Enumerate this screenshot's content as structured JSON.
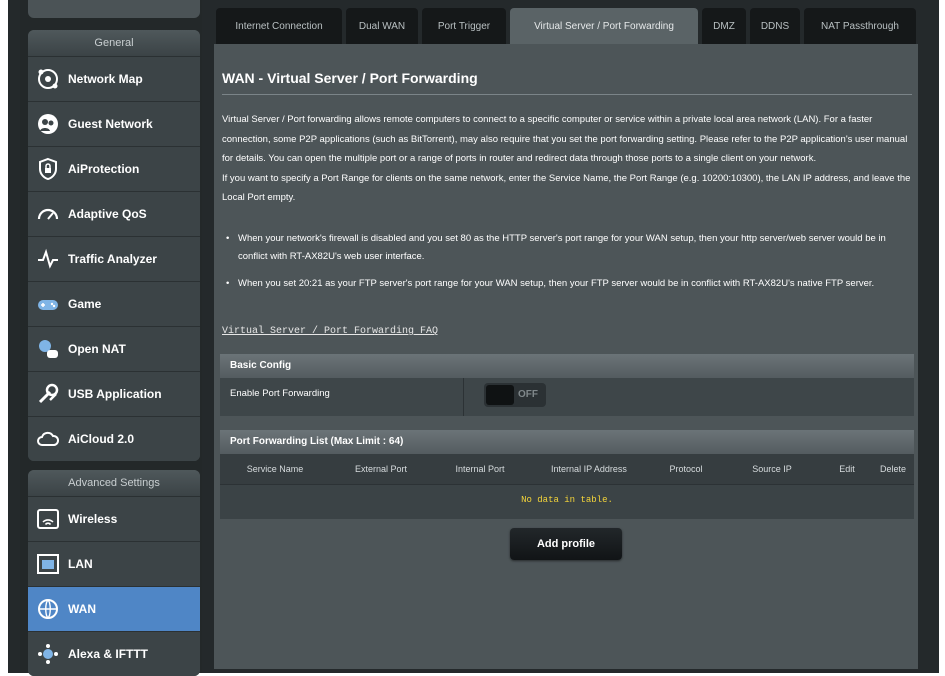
{
  "colors": {
    "accent": "#4f86c6",
    "no_data_text": "#f3d43a",
    "panel": "#4d5558",
    "sidebar_item": "#3c4447"
  },
  "tabs": [
    {
      "label": "Internet Connection",
      "active": false
    },
    {
      "label": "Dual WAN",
      "active": false
    },
    {
      "label": "Port Trigger",
      "active": false
    },
    {
      "label": "Virtual Server / Port Forwarding",
      "active": true
    },
    {
      "label": "DMZ",
      "active": false
    },
    {
      "label": "DDNS",
      "active": false
    },
    {
      "label": "NAT Passthrough",
      "active": false
    }
  ],
  "sidebar": {
    "general_header": "General",
    "general_items": [
      {
        "label": "Network Map",
        "icon": "network-map-icon"
      },
      {
        "label": "Guest Network",
        "icon": "guest-network-icon"
      },
      {
        "label": "AiProtection",
        "icon": "shield-lock-icon"
      },
      {
        "label": "Adaptive QoS",
        "icon": "speedometer-icon"
      },
      {
        "label": "Traffic Analyzer",
        "icon": "pulse-icon"
      },
      {
        "label": "Game",
        "icon": "gamepad-icon"
      },
      {
        "label": "Open NAT",
        "icon": "open-nat-icon"
      },
      {
        "label": "USB Application",
        "icon": "usb-tools-icon"
      },
      {
        "label": "AiCloud 2.0",
        "icon": "cloud-icon"
      }
    ],
    "advanced_header": "Advanced Settings",
    "advanced_items": [
      {
        "label": "Wireless",
        "icon": "wifi-icon",
        "active": false
      },
      {
        "label": "LAN",
        "icon": "lan-icon",
        "active": false
      },
      {
        "label": "WAN",
        "icon": "globe-icon",
        "active": true
      },
      {
        "label": "Alexa & IFTTT",
        "icon": "alexa-icon",
        "active": false
      }
    ]
  },
  "main": {
    "title": "WAN - Virtual Server / Port Forwarding",
    "description_1": "Virtual Server / Port forwarding allows remote computers to connect to a specific computer or service within a private local area network (LAN). For a faster connection, some P2P applications (such as BitTorrent), may also require that you set the port forwarding setting. Please refer to the P2P application's user manual for details. You can open the multiple port or a range of ports in router and redirect data through those ports to a single client on your network.",
    "description_2": "If you want to specify a Port Range for clients on the same network, enter the Service Name, the Port Range (e.g. 10200:10300), the LAN IP address, and leave the Local Port empty.",
    "bullets": [
      "When your network's firewall is disabled and you set 80 as the HTTP server's port range for your WAN setup, then your http server/web server would be in conflict with RT-AX82U's web user interface.",
      "When you set 20:21 as your FTP server's port range for your WAN setup, then your FTP server would be in conflict with RT-AX82U's native FTP server."
    ],
    "faq_link": "Virtual Server / Port Forwarding FAQ",
    "basic_config": {
      "header": "Basic Config",
      "enable_label": "Enable Port Forwarding",
      "toggle_state": "OFF"
    },
    "pf_list": {
      "header": "Port Forwarding List (Max Limit : 64)",
      "columns": [
        "Service Name",
        "External Port",
        "Internal Port",
        "Internal IP Address",
        "Protocol",
        "Source IP",
        "Edit",
        "Delete"
      ],
      "empty_text": "No data in table."
    },
    "add_button": "Add profile"
  }
}
